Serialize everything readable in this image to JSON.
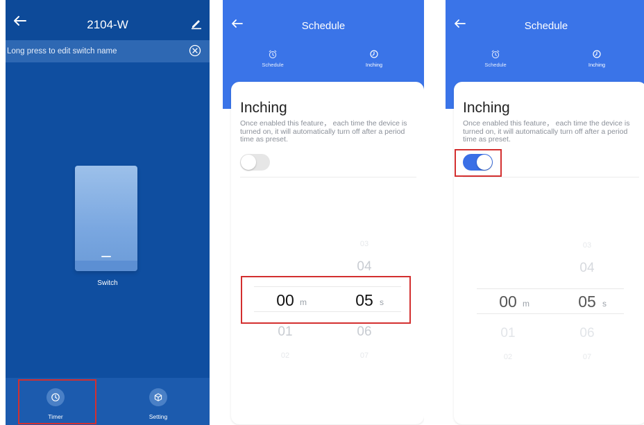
{
  "screen1": {
    "title": "2104-W",
    "hint": "Long press to edit switch name",
    "switch_label": "Switch",
    "nav": [
      {
        "label": "Timer",
        "icon": "clock-icon"
      },
      {
        "label": "Setting",
        "icon": "cube-icon"
      }
    ],
    "colors": {
      "background": "#0f4ea0",
      "hint_bar": "#2e68b3",
      "bottom_bar": "#1c5bae",
      "highlight": "#d32f2f"
    }
  },
  "screen2": {
    "title": "Schedule",
    "tabs": [
      {
        "label": "Schedule",
        "icon": "alarm-clock-icon"
      },
      {
        "label": "Inching",
        "icon": "clock-icon",
        "active": true
      }
    ],
    "heading": "Inching",
    "description": "Once enabled this feature， each time the device is turned on, it will automatically turn off after a period time as preset.",
    "toggle_on": false,
    "minutes": {
      "far_above": "",
      "above": "",
      "selected": "00",
      "below": "01",
      "far_below": "02"
    },
    "seconds": {
      "far_above": "03",
      "above": "04",
      "selected": "05",
      "below": "06",
      "far_below": "07"
    },
    "minute_unit": "m",
    "second_unit": "s"
  },
  "screen3": {
    "title": "Schedule",
    "tabs": [
      {
        "label": "Schedule",
        "icon": "alarm-clock-icon"
      },
      {
        "label": "Inching",
        "icon": "clock-icon",
        "active": true
      }
    ],
    "heading": "Inching",
    "description": "Once enabled this feature， each time the device is turned on, it will automatically turn off after a period time as preset.",
    "toggle_on": true,
    "minutes": {
      "far_above": "",
      "above": "",
      "selected": "00",
      "below": "01",
      "far_below": "02"
    },
    "seconds": {
      "far_above": "03",
      "above": "04",
      "selected": "05",
      "below": "06",
      "far_below": "07"
    },
    "minute_unit": "m",
    "second_unit": "s",
    "colors": {
      "header": "#3a74e8",
      "toggle_on": "#3a6fe6"
    }
  }
}
